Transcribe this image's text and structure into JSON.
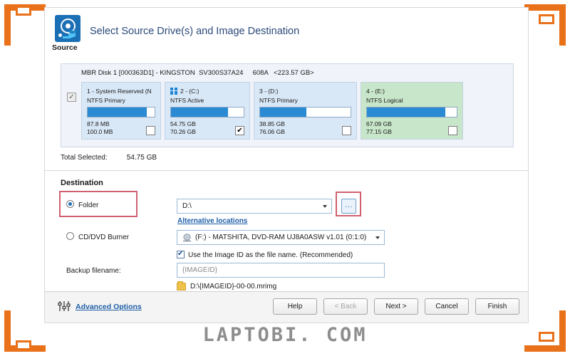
{
  "header": {
    "source_label": "Source",
    "title": "Select Source Drive(s) and Image Destination",
    "icon": "hard-disk-source-icon"
  },
  "source_panel": {
    "disk_line": "MBR Disk 1 [000363D1] - KINGSTON  SV300S37A24     608A   <223.57 GB>",
    "disk_checkbox_checked": true,
    "partitions": [
      {
        "title": "1 - System Reserved (N",
        "filesystem": "NTFS Primary",
        "used": "87.8 MB",
        "total": "100.0 MB",
        "fill_percent": 88,
        "checked": false,
        "color": "blue",
        "has_windows_icon": false
      },
      {
        "title": "2 -  (C:)",
        "filesystem": "NTFS Active",
        "used": "54.75 GB",
        "total": "70.26 GB",
        "fill_percent": 78,
        "checked": true,
        "color": "blue",
        "has_windows_icon": true
      },
      {
        "title": "3 -  (D:)",
        "filesystem": "NTFS Primary",
        "used": "38.85 GB",
        "total": "76.06 GB",
        "fill_percent": 51,
        "checked": false,
        "color": "blue",
        "has_windows_icon": false
      },
      {
        "title": "4 -  (E:)",
        "filesystem": "NTFS Logical",
        "used": "67.09 GB",
        "total": "77.15 GB",
        "fill_percent": 87,
        "checked": false,
        "color": "green",
        "has_windows_icon": false
      }
    ]
  },
  "total": {
    "label": "Total Selected:",
    "value": "54.75 GB"
  },
  "destination": {
    "section_title": "Destination",
    "folder_radio_label": "Folder",
    "folder_radio_selected": true,
    "folder_path_value": "D:\\",
    "browse_button_label": "...",
    "alternative_locations_link": "Alternative locations",
    "cddvd_radio_label": "CD/DVD Burner",
    "cddvd_radio_selected": false,
    "cddvd_value": "(F:) - MATSHITA, DVD-RAM UJ8A0ASW v1.01 (0:1:0)",
    "use_imageid_label": "Use the Image ID as the file name.  (Recommended)",
    "use_imageid_checked": true,
    "backup_filename_label": "Backup filename:",
    "backup_filename_value": "{IMAGEID}",
    "resulting_path": "D:\\{IMAGEID}-00-00.mrimg"
  },
  "footer": {
    "advanced_options_link": "Advanced Options",
    "buttons": [
      {
        "label": "Help",
        "disabled": false
      },
      {
        "label": "< Back",
        "disabled": true
      },
      {
        "label": "Next >",
        "disabled": false
      },
      {
        "label": "Cancel",
        "disabled": false
      },
      {
        "label": "Finish",
        "disabled": false
      }
    ]
  },
  "watermark": "LAPTOBI. COM",
  "colors": {
    "accent_orange": "#e8711a",
    "partition_blue": "#2a8bd4",
    "panel_blue": "#d9e8f7",
    "panel_green": "#c8e6c9",
    "link_blue": "#1f5fa8",
    "annotation_red": "#d06070",
    "title_blue": "#2b4a7a"
  }
}
